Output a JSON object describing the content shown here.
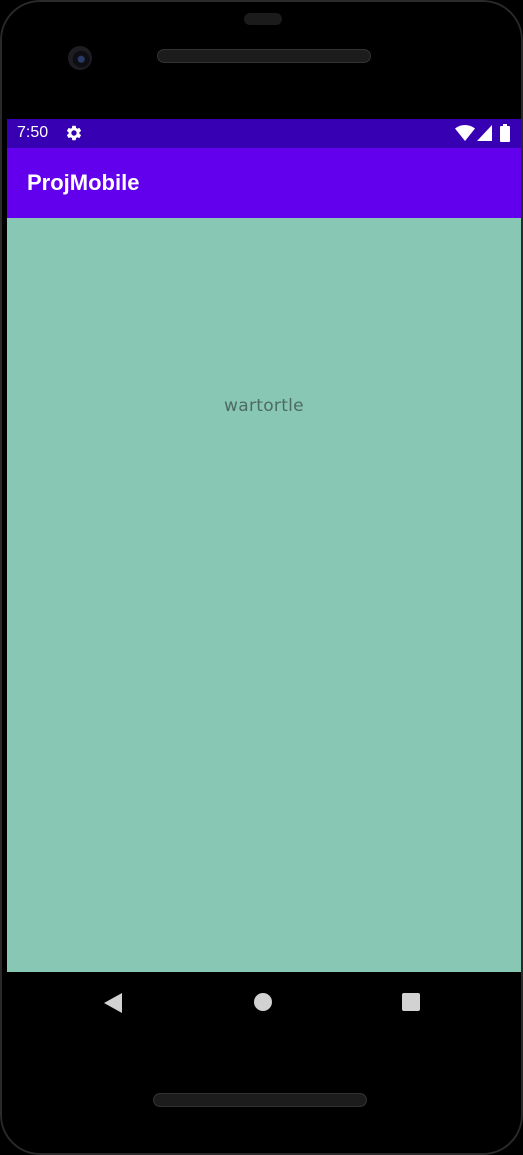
{
  "status_bar": {
    "time": "7:50",
    "icons": [
      "gear-icon",
      "wifi-icon",
      "signal-icon",
      "battery-icon"
    ]
  },
  "app_bar": {
    "title": "ProjMobile"
  },
  "content": {
    "pokemon_name": "wartortle"
  },
  "nav_bar": {
    "buttons": [
      "back-icon",
      "home-icon",
      "recents-icon"
    ]
  },
  "colors": {
    "status_bar": "#3700b3",
    "app_bar": "#6200ee",
    "background": "#88c7b3",
    "text": "#4e6a62"
  }
}
